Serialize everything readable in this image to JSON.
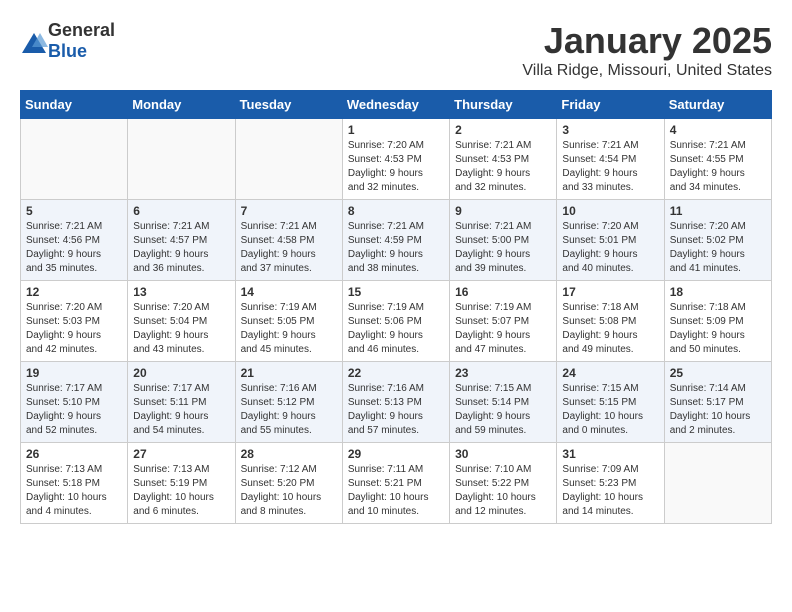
{
  "header": {
    "logo_general": "General",
    "logo_blue": "Blue",
    "month_title": "January 2025",
    "location": "Villa Ridge, Missouri, United States"
  },
  "days_of_week": [
    "Sunday",
    "Monday",
    "Tuesday",
    "Wednesday",
    "Thursday",
    "Friday",
    "Saturday"
  ],
  "weeks": [
    [
      {
        "day": "",
        "info": ""
      },
      {
        "day": "",
        "info": ""
      },
      {
        "day": "",
        "info": ""
      },
      {
        "day": "1",
        "info": "Sunrise: 7:20 AM\nSunset: 4:53 PM\nDaylight: 9 hours\nand 32 minutes."
      },
      {
        "day": "2",
        "info": "Sunrise: 7:21 AM\nSunset: 4:53 PM\nDaylight: 9 hours\nand 32 minutes."
      },
      {
        "day": "3",
        "info": "Sunrise: 7:21 AM\nSunset: 4:54 PM\nDaylight: 9 hours\nand 33 minutes."
      },
      {
        "day": "4",
        "info": "Sunrise: 7:21 AM\nSunset: 4:55 PM\nDaylight: 9 hours\nand 34 minutes."
      }
    ],
    [
      {
        "day": "5",
        "info": "Sunrise: 7:21 AM\nSunset: 4:56 PM\nDaylight: 9 hours\nand 35 minutes."
      },
      {
        "day": "6",
        "info": "Sunrise: 7:21 AM\nSunset: 4:57 PM\nDaylight: 9 hours\nand 36 minutes."
      },
      {
        "day": "7",
        "info": "Sunrise: 7:21 AM\nSunset: 4:58 PM\nDaylight: 9 hours\nand 37 minutes."
      },
      {
        "day": "8",
        "info": "Sunrise: 7:21 AM\nSunset: 4:59 PM\nDaylight: 9 hours\nand 38 minutes."
      },
      {
        "day": "9",
        "info": "Sunrise: 7:21 AM\nSunset: 5:00 PM\nDaylight: 9 hours\nand 39 minutes."
      },
      {
        "day": "10",
        "info": "Sunrise: 7:20 AM\nSunset: 5:01 PM\nDaylight: 9 hours\nand 40 minutes."
      },
      {
        "day": "11",
        "info": "Sunrise: 7:20 AM\nSunset: 5:02 PM\nDaylight: 9 hours\nand 41 minutes."
      }
    ],
    [
      {
        "day": "12",
        "info": "Sunrise: 7:20 AM\nSunset: 5:03 PM\nDaylight: 9 hours\nand 42 minutes."
      },
      {
        "day": "13",
        "info": "Sunrise: 7:20 AM\nSunset: 5:04 PM\nDaylight: 9 hours\nand 43 minutes."
      },
      {
        "day": "14",
        "info": "Sunrise: 7:19 AM\nSunset: 5:05 PM\nDaylight: 9 hours\nand 45 minutes."
      },
      {
        "day": "15",
        "info": "Sunrise: 7:19 AM\nSunset: 5:06 PM\nDaylight: 9 hours\nand 46 minutes."
      },
      {
        "day": "16",
        "info": "Sunrise: 7:19 AM\nSunset: 5:07 PM\nDaylight: 9 hours\nand 47 minutes."
      },
      {
        "day": "17",
        "info": "Sunrise: 7:18 AM\nSunset: 5:08 PM\nDaylight: 9 hours\nand 49 minutes."
      },
      {
        "day": "18",
        "info": "Sunrise: 7:18 AM\nSunset: 5:09 PM\nDaylight: 9 hours\nand 50 minutes."
      }
    ],
    [
      {
        "day": "19",
        "info": "Sunrise: 7:17 AM\nSunset: 5:10 PM\nDaylight: 9 hours\nand 52 minutes."
      },
      {
        "day": "20",
        "info": "Sunrise: 7:17 AM\nSunset: 5:11 PM\nDaylight: 9 hours\nand 54 minutes."
      },
      {
        "day": "21",
        "info": "Sunrise: 7:16 AM\nSunset: 5:12 PM\nDaylight: 9 hours\nand 55 minutes."
      },
      {
        "day": "22",
        "info": "Sunrise: 7:16 AM\nSunset: 5:13 PM\nDaylight: 9 hours\nand 57 minutes."
      },
      {
        "day": "23",
        "info": "Sunrise: 7:15 AM\nSunset: 5:14 PM\nDaylight: 9 hours\nand 59 minutes."
      },
      {
        "day": "24",
        "info": "Sunrise: 7:15 AM\nSunset: 5:15 PM\nDaylight: 10 hours\nand 0 minutes."
      },
      {
        "day": "25",
        "info": "Sunrise: 7:14 AM\nSunset: 5:17 PM\nDaylight: 10 hours\nand 2 minutes."
      }
    ],
    [
      {
        "day": "26",
        "info": "Sunrise: 7:13 AM\nSunset: 5:18 PM\nDaylight: 10 hours\nand 4 minutes."
      },
      {
        "day": "27",
        "info": "Sunrise: 7:13 AM\nSunset: 5:19 PM\nDaylight: 10 hours\nand 6 minutes."
      },
      {
        "day": "28",
        "info": "Sunrise: 7:12 AM\nSunset: 5:20 PM\nDaylight: 10 hours\nand 8 minutes."
      },
      {
        "day": "29",
        "info": "Sunrise: 7:11 AM\nSunset: 5:21 PM\nDaylight: 10 hours\nand 10 minutes."
      },
      {
        "day": "30",
        "info": "Sunrise: 7:10 AM\nSunset: 5:22 PM\nDaylight: 10 hours\nand 12 minutes."
      },
      {
        "day": "31",
        "info": "Sunrise: 7:09 AM\nSunset: 5:23 PM\nDaylight: 10 hours\nand 14 minutes."
      },
      {
        "day": "",
        "info": ""
      }
    ]
  ]
}
